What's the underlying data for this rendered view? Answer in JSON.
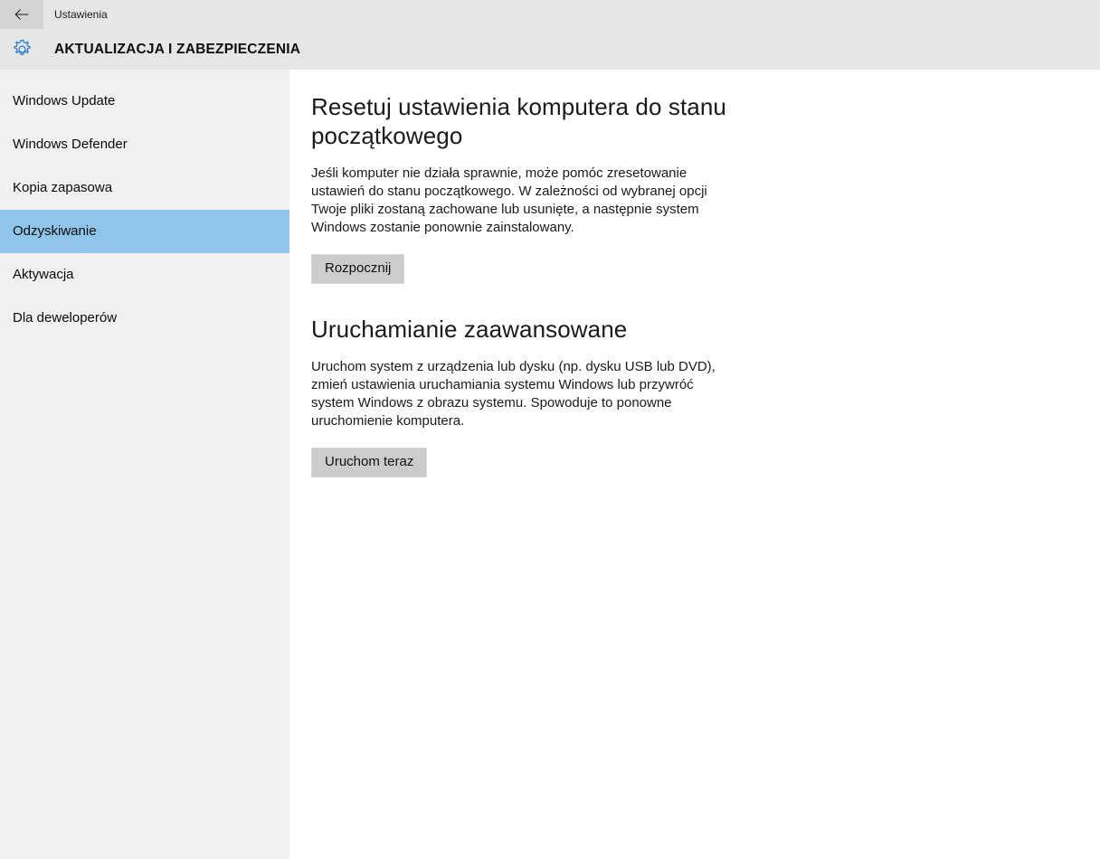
{
  "window": {
    "titlebar": {
      "back_icon": "arrow-left-icon",
      "app_title": "Ustawienia"
    },
    "header": {
      "icon": "gear-icon",
      "title": "AKTUALIZACJA I ZABEZPIECZENIA"
    }
  },
  "sidebar": {
    "background_color": "#f0f0f0",
    "selected_color": "#8fc5ea",
    "items": [
      {
        "label": "Windows Update",
        "selected": false
      },
      {
        "label": "Windows Defender",
        "selected": false
      },
      {
        "label": "Kopia zapasowa",
        "selected": false
      },
      {
        "label": "Odzyskiwanie",
        "selected": true
      },
      {
        "label": "Aktywacja",
        "selected": false
      },
      {
        "label": "Dla deweloperów",
        "selected": false
      }
    ]
  },
  "main": {
    "sections": [
      {
        "heading_line1": "Resetuj ustawienia komputera do stanu",
        "heading_line2": "początkowego",
        "body_lines": [
          "Jeśli komputer nie działa sprawnie, może pomóc zresetowanie",
          "ustawień do stanu początkowego. W zależności od wybranej opcji",
          "Twoje pliki zostaną zachowane lub usunięte, a następnie system",
          "Windows zostanie ponownie zainstalowany."
        ],
        "button_label": "Rozpocznij"
      },
      {
        "heading_line1": "Uruchamianie zaawansowane",
        "heading_line2": "",
        "body_lines": [
          "Uruchom system z urządzenia lub dysku (np. dysku USB lub DVD),",
          "zmień ustawienia uruchamiania systemu Windows lub przywróć",
          "system Windows z obrazu systemu. Spowoduje to ponowne",
          "uruchomienie komputera."
        ],
        "button_label": "Uruchom teraz"
      }
    ]
  },
  "colors": {
    "header_band": "#e6e6e6",
    "accent_icon": "#2b7cd3",
    "button_face": "#cccccc"
  }
}
